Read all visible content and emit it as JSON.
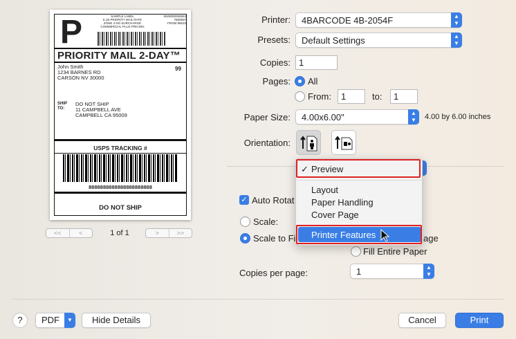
{
  "preview": {
    "p_letter": "P",
    "sample_block": "SAMPLE LABEL\n6 LB PRIORITY MAIL RATE\nZONE 4 NO SURCHARGE\nCOMMERCIAL PLUS PRICING",
    "code_block": "0625000093842\n7650937\nFROM 96610",
    "service": "PRIORITY MAIL 2-DAY™",
    "sender": "John Smith\n1234 BARNES RD\nCARSON NV 30000",
    "zone": "99",
    "ship_to_label": "SHIP\nTO:",
    "recipient": "DO NOT SHIP\n11 CAMPBELL AVE\nCAMPBELL CA 95009",
    "tracking_label": "USPS TRACKING #",
    "tracking_number": "8888888888888888888888",
    "footer": "DO NOT SHIP"
  },
  "page_nav": {
    "first": "<<",
    "prev": "<",
    "page_indicator": "1 of 1",
    "next": ">",
    "last": ">>"
  },
  "printer": {
    "label": "Printer:",
    "value": "4BARCODE 4B-2054F"
  },
  "presets": {
    "label": "Presets:",
    "value": "Default Settings"
  },
  "copies": {
    "label": "Copies:",
    "value": "1"
  },
  "pages": {
    "label": "Pages:",
    "all_label": "All",
    "from_label": "From:",
    "from_value": "1",
    "to_label": "to:",
    "to_value": "1"
  },
  "paper_size": {
    "label": "Paper Size:",
    "value": "4.00x6.00\"",
    "description": "4.00 by 6.00 inches"
  },
  "orientation": {
    "label": "Orientation:"
  },
  "section_menu": {
    "check": "✓",
    "items": [
      "Preview",
      "Layout",
      "Paper Handling",
      "Cover Page",
      "Printer Features"
    ]
  },
  "scaling": {
    "auto_rotate": "Auto Rotat",
    "scale": "Scale:",
    "scale_to_fit": "Scale to Fi",
    "page_suffix": "age",
    "fill_entire": "Fill Entire Paper"
  },
  "copies_per_page": {
    "label": "Copies per page:",
    "value": "1"
  },
  "footer": {
    "help": "?",
    "pdf": "PDF",
    "hide_details": "Hide Details",
    "cancel": "Cancel",
    "print": "Print"
  },
  "colors": {
    "accent": "#3a7ee5",
    "highlight_box": "#e02020"
  }
}
